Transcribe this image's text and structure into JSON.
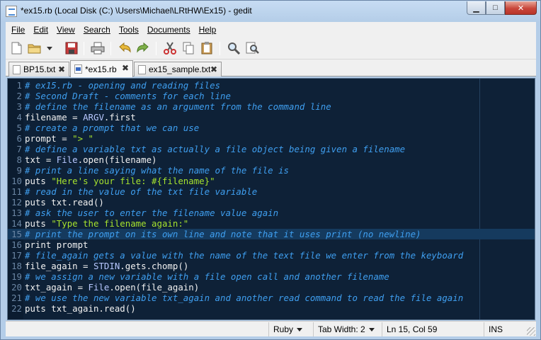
{
  "window": {
    "title": "*ex15.rb (Local Disk (C:) \\Users\\Michael\\LRtHW\\Ex15) - gedit",
    "minimize_glyph": "▁",
    "maximize_glyph": "□",
    "close_glyph": "✕"
  },
  "menu": [
    "File",
    "Edit",
    "View",
    "Search",
    "Tools",
    "Documents",
    "Help"
  ],
  "toolbar": {
    "buttons": [
      "new-icon",
      "open-icon",
      "open-dropdown-icon",
      "save-icon",
      "print-icon",
      "undo-icon",
      "redo-icon",
      "cut-icon",
      "copy-icon",
      "paste-icon",
      "find-icon",
      "replace-icon"
    ]
  },
  "tabs": [
    {
      "label": "BP15.txt",
      "close": "✖",
      "active": false
    },
    {
      "label": "*ex15.rb",
      "close": "✖",
      "active": true
    },
    {
      "label": "ex15_sample.txt",
      "close": "✖",
      "active": false
    }
  ],
  "editor": {
    "current_line": 15,
    "lines": [
      {
        "n": "1",
        "tokens": [
          {
            "t": "comment",
            "v": "# ex15.rb - opening and reading files"
          }
        ]
      },
      {
        "n": "2",
        "tokens": [
          {
            "t": "comment",
            "v": "# Second Draft - comments for each line"
          }
        ]
      },
      {
        "n": "3",
        "tokens": [
          {
            "t": "comment",
            "v": "# define the filename as an argument from the command line"
          }
        ]
      },
      {
        "n": "4",
        "tokens": [
          {
            "t": "plain",
            "v": "filename = "
          },
          {
            "t": "const",
            "v": "ARGV"
          },
          {
            "t": "plain",
            "v": ".first"
          }
        ]
      },
      {
        "n": "5",
        "tokens": [
          {
            "t": "comment",
            "v": "# create a prompt that we can use"
          }
        ]
      },
      {
        "n": "6",
        "tokens": [
          {
            "t": "plain",
            "v": "prompt = "
          },
          {
            "t": "string",
            "v": "\"> \""
          }
        ]
      },
      {
        "n": "7",
        "tokens": [
          {
            "t": "comment",
            "v": "# define a variable txt as actually a file object being given a filename"
          }
        ]
      },
      {
        "n": "8",
        "tokens": [
          {
            "t": "plain",
            "v": "txt = "
          },
          {
            "t": "const",
            "v": "File"
          },
          {
            "t": "plain",
            "v": ".open(filename)"
          }
        ]
      },
      {
        "n": "9",
        "tokens": [
          {
            "t": "comment",
            "v": "# print a line saying what the name of the file is"
          }
        ]
      },
      {
        "n": "10",
        "tokens": [
          {
            "t": "plain",
            "v": "puts "
          },
          {
            "t": "string",
            "v": "\"Here's your file: #{filename}\""
          }
        ]
      },
      {
        "n": "11",
        "tokens": [
          {
            "t": "comment",
            "v": "# read in the value of the txt file variable"
          }
        ]
      },
      {
        "n": "12",
        "tokens": [
          {
            "t": "plain",
            "v": "puts txt.read()"
          }
        ]
      },
      {
        "n": "13",
        "tokens": [
          {
            "t": "comment",
            "v": "# ask the user to enter the filename value again"
          }
        ]
      },
      {
        "n": "14",
        "tokens": [
          {
            "t": "plain",
            "v": "puts "
          },
          {
            "t": "string",
            "v": "\"Type the filename again:\""
          }
        ]
      },
      {
        "n": "15",
        "tokens": [
          {
            "t": "comment",
            "v": "# print the prompt on its own line and note that it uses print (no newline)"
          }
        ]
      },
      {
        "n": "16",
        "tokens": [
          {
            "t": "plain",
            "v": "print prompt"
          }
        ]
      },
      {
        "n": "17",
        "tokens": [
          {
            "t": "comment",
            "v": "# file_again gets a value with the name of the text file we enter from the keyboard"
          }
        ]
      },
      {
        "n": "18",
        "tokens": [
          {
            "t": "plain",
            "v": "file_again = "
          },
          {
            "t": "const",
            "v": "STDIN"
          },
          {
            "t": "plain",
            "v": ".gets.chomp()"
          }
        ]
      },
      {
        "n": "19",
        "tokens": [
          {
            "t": "comment",
            "v": "# we assign a new variable with a file open call and another filename"
          }
        ]
      },
      {
        "n": "20",
        "tokens": [
          {
            "t": "plain",
            "v": "txt_again = "
          },
          {
            "t": "const",
            "v": "File"
          },
          {
            "t": "plain",
            "v": ".open(file_again)"
          }
        ]
      },
      {
        "n": "21",
        "tokens": [
          {
            "t": "comment",
            "v": "# we use the new variable txt_again and another read command to read the file again"
          }
        ]
      },
      {
        "n": "22",
        "tokens": [
          {
            "t": "plain",
            "v": "puts txt_again.read()"
          }
        ]
      }
    ]
  },
  "statusbar": {
    "language": "Ruby",
    "tab_width": "Tab Width:  2",
    "position": "Ln 15, Col 59",
    "mode": "INS"
  },
  "colors": {
    "editor_bg": "#0e2137",
    "comment": "#3f9ff0",
    "string": "#a6e22e",
    "current_line": "#153a5e"
  }
}
